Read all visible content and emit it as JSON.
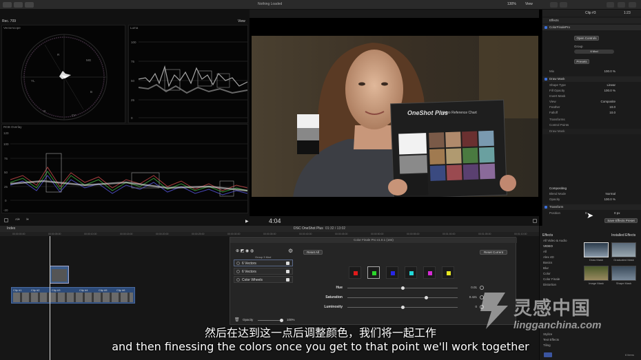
{
  "topbar": {
    "center_status": "Nothing Loaded",
    "zoom": "130%",
    "view_label": "View",
    "inspector_title": "Clip #3",
    "inspector_time": "1:23"
  },
  "scopes": {
    "rec_label": "Rec. 709",
    "view_label": "View",
    "vectorscope_label": "Vectorscope",
    "luma_label": "Luma",
    "rgb_overlay_label": "RGB Overlay",
    "luma_ticks": [
      "100",
      "75",
      "50",
      "25",
      "0"
    ],
    "rgb_ticks": [
      "120",
      "100",
      "75",
      "50",
      "25",
      "0",
      "-20"
    ],
    "vector_targets": [
      "R",
      "MG",
      "B",
      "CY",
      "G",
      "YL"
    ]
  },
  "viewer": {
    "timecode": "4:04",
    "chart_title": "OneShot Plus",
    "chart_subtitle": "Video Reference Chart"
  },
  "inspector": {
    "effects_label": "Effects",
    "effect_name": "ColorFinalePro",
    "open_controls": "Open Controls",
    "group_label": "Group",
    "group_value": "6 Mod",
    "presets": "Presets",
    "mix_label": "Mix",
    "mix_value": "100.0 %",
    "draw_mask": "Draw Mask",
    "shape_type_label": "Shape Type",
    "shape_type_value": "Linear",
    "fill_opacity_label": "Fill Opacity",
    "fill_opacity_value": "100.0 %",
    "invert_mask_label": "Invert Mask",
    "view_label": "View",
    "view_value": "Composite",
    "feather_label": "Feather",
    "feather_value": "10.0",
    "falloff_label": "Falloff",
    "falloff_value": "10.0",
    "transforms_label": "Transforms",
    "control_points_label": "Control Points",
    "draw_mask2": "Draw Mask",
    "compositing_label": "Compositing",
    "blend_mode_label": "Blend Mode",
    "blend_mode_value": "Normal",
    "opacity_label": "Opacity",
    "opacity_value": "100.0 %",
    "transform_label": "Transform",
    "position_label": "Position",
    "position_x": "0",
    "position_y": "0 px",
    "save_effects_preset": "Save Effects Preset"
  },
  "timeline": {
    "index_label": "Index",
    "project_title": "DSC OneShot Plus",
    "project_time": "01:32 / 13:02",
    "ruler_ticks": [
      "00:00:00:00",
      "00:00:05:00",
      "00:00:10:00",
      "00:00:15:00",
      "00:00:20:00",
      "00:00:25:00",
      "00:00:30:00",
      "00:00:35:00",
      "00:00:40:00",
      "00:00:45:00",
      "00:00:50:00",
      "00:00:55:00",
      "00:01:00:00",
      "00:01:05:00",
      "00:01:10:00"
    ],
    "clips": [
      "Clip #1",
      "Clip #2",
      "Clip #3",
      "Clip #4",
      "Clip #5",
      "Clip #6"
    ]
  },
  "color_finale": {
    "title": "Color Finale Pro v1.0.1 (184)",
    "group_label": "Group 3 Mod",
    "reset_all": "Reset All",
    "reset_current": "Reset Current",
    "layers": [
      "6 Vectors",
      "6 Vectors",
      "Color Wheels"
    ],
    "opacity_label": "Opacity",
    "opacity_value": "100%",
    "swatch_colors": [
      "#e01a1a",
      "#2bd62b",
      "#2727e6",
      "#22d8d8",
      "#d62bd6",
      "#e6e622"
    ],
    "sliders": [
      {
        "label": "Hue",
        "value": "0.01",
        "pos": 0.5
      },
      {
        "label": "Saturation",
        "value": "0.421",
        "pos": 0.71
      },
      {
        "label": "Luminosity",
        "value": "0",
        "pos": 0.5
      }
    ]
  },
  "effects_browser": {
    "header_left": "Effects",
    "header_right": "Installed Effects",
    "categories": [
      "All Video & Audio",
      "VIDEO",
      "All",
      "Alex 4D",
      "Basics",
      "Blur",
      "Color",
      "Color Finale",
      "Distortion",
      "",
      "",
      "",
      "",
      "",
      "Stylize",
      "Text Effects",
      "Tiling"
    ],
    "thumbs": [
      "Draw Mask",
      "Graduated Mask",
      "Image Mask",
      "Shape Mask"
    ],
    "count": "6 items"
  },
  "subtitles": {
    "cn": "然后在达到这一点后调整颜色，我们将一起工作",
    "en": "and then finessing the colors once you get to that point we'll work together"
  },
  "watermark": {
    "logo": "灵感中国",
    "url": "lingganchina.com"
  }
}
